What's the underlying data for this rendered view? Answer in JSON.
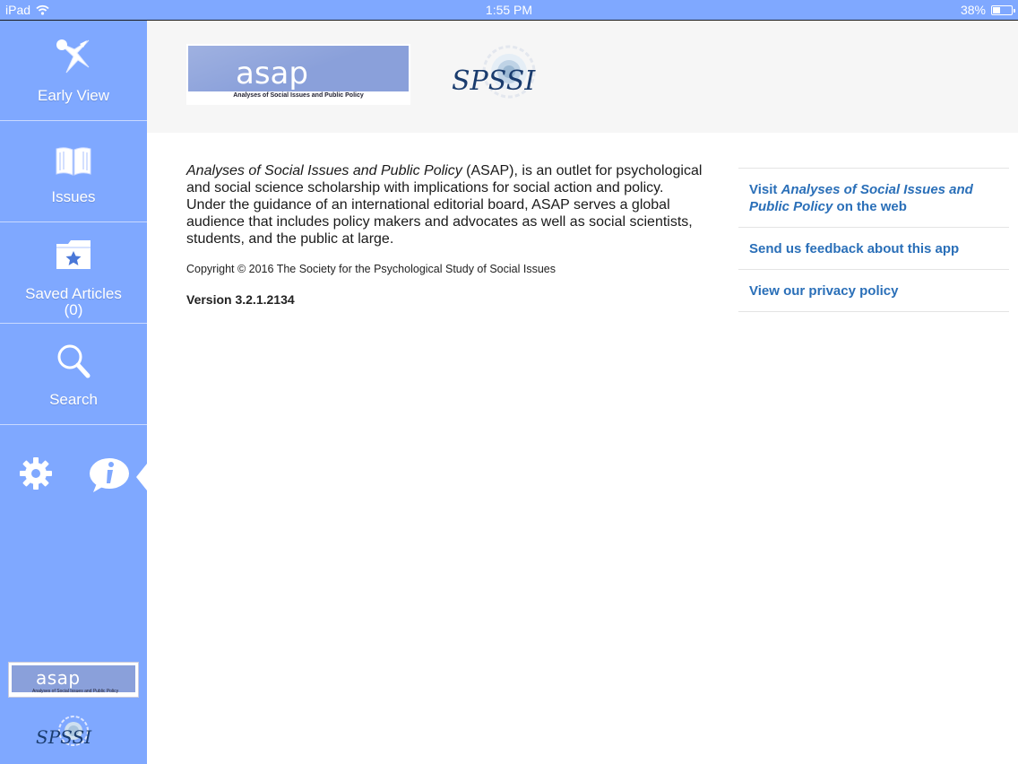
{
  "status_bar": {
    "device": "iPad",
    "time": "1:55 PM",
    "battery_percent": "38%",
    "battery_level": 0.38
  },
  "sidebar": {
    "items": [
      {
        "label": "Early View",
        "icon": "early-view-icon"
      },
      {
        "label": "Issues",
        "icon": "book-icon"
      },
      {
        "label": "Saved Articles",
        "count": "(0)",
        "icon": "starred-folder-icon"
      },
      {
        "label": "Search",
        "icon": "magnifier-icon"
      }
    ],
    "tools": [
      {
        "icon": "gear-icon"
      },
      {
        "icon": "info-bubble-icon",
        "selected": true
      }
    ]
  },
  "logos": {
    "asap_wordmark": "asap",
    "asap_subtitle": "Analyses of Social Issues and Public Policy",
    "spssi_wordmark": "SPSSI"
  },
  "about": {
    "journal_title": "Analyses of Social Issues and Public Policy",
    "description_rest": " (ASAP), is an outlet for psychological and social science scholarship with implications for social action and policy. Under the guidance of an international editorial board, ASAP serves a global audience that includes policy makers and advocates as well as social scientists, students, and the public at large.",
    "copyright": "Copyright © 2016 The Society for the Psychological Study of Social Issues",
    "version": "Version 3.2.1.2134"
  },
  "links": {
    "visit_prefix": "Visit ",
    "visit_title": "Analyses of Social Issues and Public Policy",
    "visit_suffix": " on the web",
    "feedback": "Send us feedback about this app",
    "privacy": "View our privacy policy"
  },
  "colors": {
    "sidebar": "#7fa8ff",
    "link": "#2a6fb8",
    "header_bg": "#f6f6f6"
  }
}
